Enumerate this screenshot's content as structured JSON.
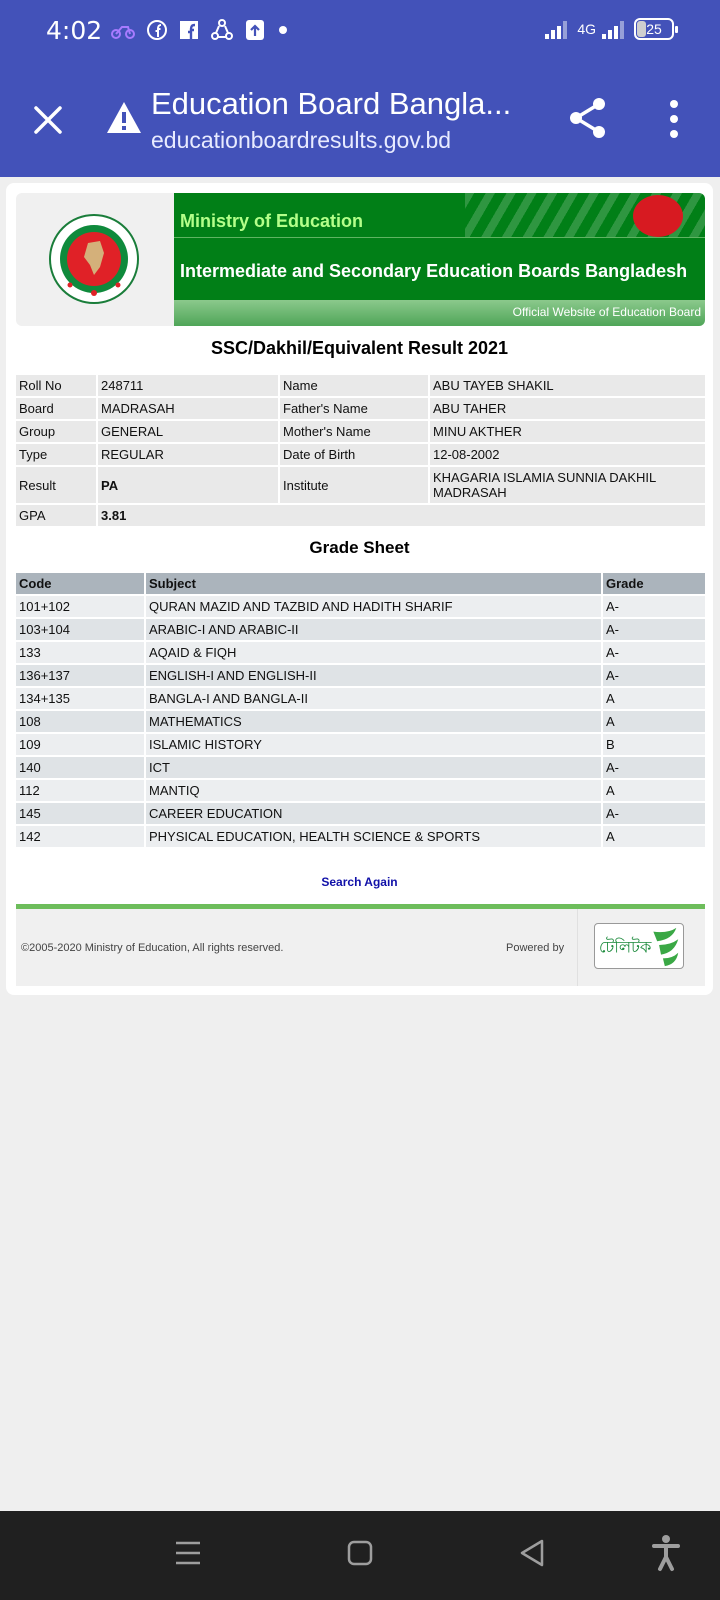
{
  "status_bar": {
    "time": "4:02",
    "network": "4G",
    "battery": "25"
  },
  "tab": {
    "title": "Education Board Bangla...",
    "url": "educationboardresults.gov.bd"
  },
  "banner": {
    "ministry": "Ministry of Education",
    "boards": "Intermediate and Secondary Education Boards Bangladesh",
    "official": "Official Website of Education Board"
  },
  "result_title": "SSC/Dakhil/Equivalent Result 2021",
  "student": {
    "roll_label": "Roll No",
    "roll": "248711",
    "name_label": "Name",
    "name": "ABU TAYEB SHAKIL",
    "board_label": "Board",
    "board": "MADRASAH",
    "father_label": "Father's Name",
    "father": "ABU TAHER",
    "group_label": "Group",
    "group": "GENERAL",
    "mother_label": "Mother's Name",
    "mother": "MINU AKTHER",
    "type_label": "Type",
    "type": "REGULAR",
    "dob_label": "Date of Birth",
    "dob": "12-08-2002",
    "result_label": "Result",
    "result": "PA",
    "institute_label": "Institute",
    "institute": "KHAGARIA ISLAMIA SUNNIA DAKHIL MADRASAH",
    "gpa_label": "GPA",
    "gpa": "3.81"
  },
  "grade_sheet": {
    "title": "Grade Sheet",
    "headers": {
      "code": "Code",
      "subject": "Subject",
      "grade": "Grade"
    },
    "rows": [
      {
        "code": "101+102",
        "subject": "QURAN MAZID AND TAZBID AND HADITH SHARIF",
        "grade": "A-"
      },
      {
        "code": "103+104",
        "subject": "ARABIC-I AND ARABIC-II",
        "grade": "A-"
      },
      {
        "code": "133",
        "subject": "AQAID & FIQH",
        "grade": "A-"
      },
      {
        "code": "136+137",
        "subject": "ENGLISH-I AND ENGLISH-II",
        "grade": "A-"
      },
      {
        "code": "134+135",
        "subject": "BANGLA-I AND BANGLA-II",
        "grade": "A"
      },
      {
        "code": "108",
        "subject": "MATHEMATICS",
        "grade": "A"
      },
      {
        "code": "109",
        "subject": "ISLAMIC HISTORY",
        "grade": "B"
      },
      {
        "code": "140",
        "subject": "ICT",
        "grade": "A-"
      },
      {
        "code": "112",
        "subject": "MANTIQ",
        "grade": "A"
      },
      {
        "code": "145",
        "subject": "CAREER EDUCATION",
        "grade": "A-"
      },
      {
        "code": "142",
        "subject": "PHYSICAL EDUCATION, HEALTH SCIENCE & SPORTS",
        "grade": "A"
      }
    ]
  },
  "search_again": "Search Again",
  "footer": {
    "copyright": "©2005-2020 Ministry of Education, All rights reserved.",
    "powered_by": "Powered by",
    "logo_text": "টেলিটক"
  },
  "colors": {
    "header": "#4352b9",
    "banner_green": "#017f17",
    "footer_accent": "#6dbd5b",
    "link": "#1010a8"
  }
}
